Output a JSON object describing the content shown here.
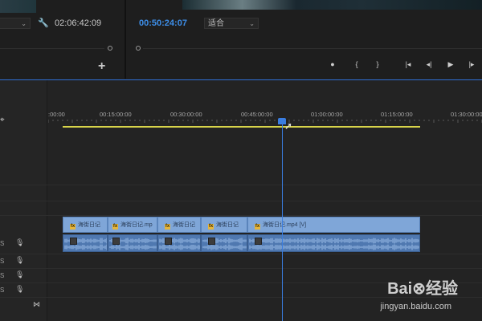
{
  "source_monitor": {
    "fit_dropdown_value": "",
    "timecode": "02:06:42:09"
  },
  "program_monitor": {
    "timecode": "00:50:24:07",
    "fit_dropdown_value": "适合",
    "transport": {
      "add_marker": "●",
      "mark_in": "{",
      "mark_out": "}",
      "go_to_in": "|◂",
      "step_back": "◂|",
      "play": "▶",
      "step_forward": "|▸"
    }
  },
  "source_add": "+",
  "timeline": {
    "ruler_labels": [
      ":00:00",
      "00:15:00:00",
      "00:30:00:00",
      "00:45:00:00",
      "01:00:00:00",
      "01:15:00:00",
      "01:30:00:00"
    ],
    "video_clips": [
      {
        "label": "海街日记"
      },
      {
        "label": "海街日记.mp"
      },
      {
        "label": "海街日记"
      },
      {
        "label": "海街日记"
      },
      {
        "label": "海街日记.mp4 [V]"
      }
    ],
    "audio_track_labels": [
      "S",
      "S",
      "S",
      "S"
    ],
    "fx_glyph": "fx"
  },
  "watermark": {
    "logo": "Bai⊗经验",
    "url": "jingyan.baidu.com"
  }
}
